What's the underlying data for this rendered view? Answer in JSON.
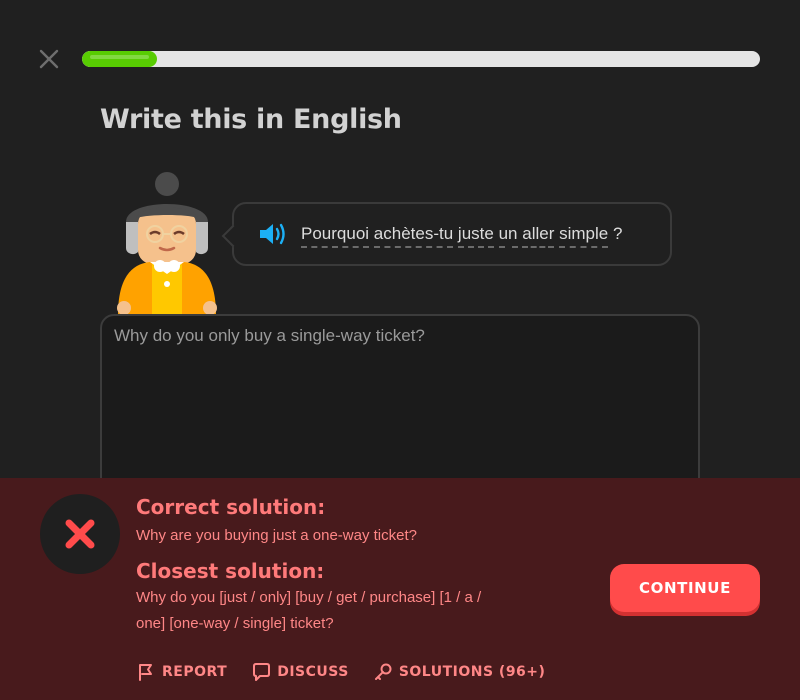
{
  "header": {
    "progress_fraction": 0.11
  },
  "exercise": {
    "title": "Write this in English",
    "prompt_words": [
      "Pourquoi",
      "achètes-tu",
      "juste",
      "un",
      "aller",
      "simple",
      "?"
    ],
    "answer_value": "Why do you only buy a single-way ticket?"
  },
  "feedback": {
    "correct_heading": "Correct solution:",
    "correct_text": "Why are you buying just a one-way ticket?",
    "closest_heading": "Closest solution:",
    "closest_line1": "Why do you [just / only] [buy / get / purchase] [1 / a /",
    "closest_line2": "one] [one-way / single] ticket?",
    "continue_label": "CONTINUE",
    "report_label": "REPORT",
    "discuss_label": "DISCUSS",
    "solutions_label": "SOLUTIONS (96+)"
  },
  "colors": {
    "background": "#202020",
    "progress": "#58cc02",
    "feedback_bg": "#481a1c",
    "feedback_text": "#ff8787",
    "continue_button": "#ff4b4b",
    "speaker": "#1cb0f6"
  }
}
